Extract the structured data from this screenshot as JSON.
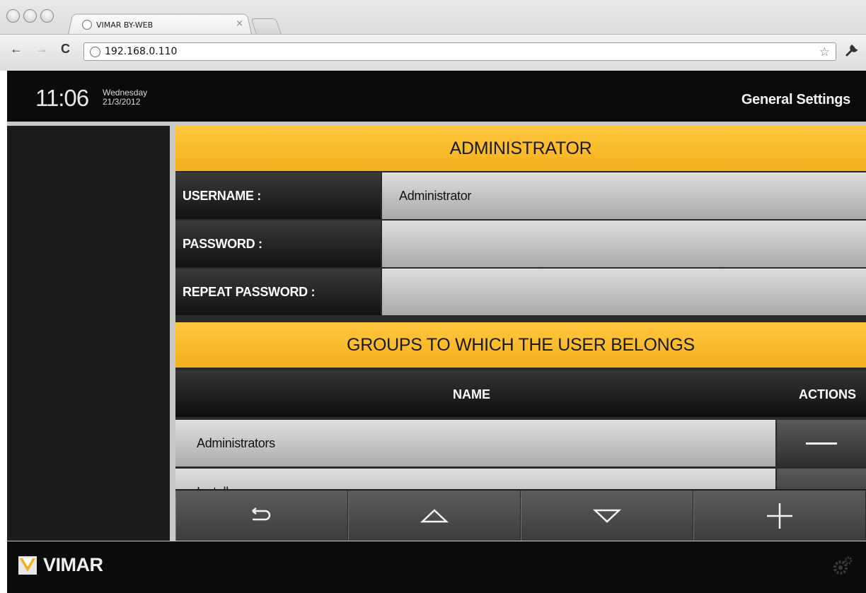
{
  "browser": {
    "tab_title": "VIMAR BY-WEB",
    "tab_close": "×",
    "url": "192.168.0.110",
    "icons": [
      "back-arrow-icon",
      "forward-arrow-icon",
      "reload-icon",
      "globe-icon",
      "star-icon",
      "wrench-icon"
    ]
  },
  "header": {
    "time": "11:06",
    "weekday": "Wednesday",
    "date": "21/3/2012",
    "title": "General Settings"
  },
  "administrator": {
    "heading": "ADMINISTRATOR",
    "fields": [
      {
        "label": "USERNAME :",
        "value": "Administrator"
      },
      {
        "label": "PASSWORD :",
        "value": ""
      },
      {
        "label": "REPEAT PASSWORD :",
        "value": ""
      }
    ]
  },
  "groups": {
    "heading": "GROUPS TO WHICH THE USER BELONGS",
    "columns": {
      "name": "NAME",
      "actions": "ACTIONS"
    },
    "rows": [
      {
        "name": "Administrators"
      },
      {
        "name": "Installers"
      }
    ]
  },
  "toolbar": {
    "buttons": [
      "back-icon",
      "up-triangle-icon",
      "down-triangle-icon",
      "plus-icon"
    ]
  },
  "footer": {
    "brand": "VIMAR",
    "icons": [
      "vimar-logo-icon",
      "gear-icon"
    ]
  },
  "colors": {
    "accent_yellow": "#f4b01c",
    "bar_dark": "#0b0b0b"
  }
}
